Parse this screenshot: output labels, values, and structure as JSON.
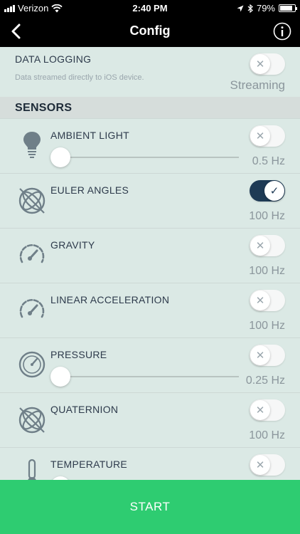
{
  "status_bar": {
    "carrier": "Verizon",
    "time": "2:40 PM",
    "battery": "79%",
    "battery_level": 0.79
  },
  "nav": {
    "title": "Config",
    "back_icon": "chevron-left-icon",
    "info_icon": "info-icon"
  },
  "logging": {
    "label": "DATA LOGGING",
    "description": "Data streamed directly to iOS device.",
    "status": "Streaming",
    "enabled": false
  },
  "sensors_header": "SENSORS",
  "sensors": [
    {
      "name": "AMBIENT LIGHT",
      "rate": "0.5 Hz",
      "enabled": false,
      "icon": "lightbulb-icon",
      "slider": 0
    },
    {
      "name": "EULER ANGLES",
      "rate": "100 Hz",
      "enabled": true,
      "icon": "gyroscope-icon"
    },
    {
      "name": "GRAVITY",
      "rate": "100 Hz",
      "enabled": false,
      "icon": "gauge-icon"
    },
    {
      "name": "LINEAR ACCELERATION",
      "rate": "100 Hz",
      "enabled": false,
      "icon": "gauge-icon"
    },
    {
      "name": "PRESSURE",
      "rate": "0.25 Hz",
      "enabled": false,
      "icon": "barometer-icon",
      "slider": 0
    },
    {
      "name": "QUATERNION",
      "rate": "100 Hz",
      "enabled": false,
      "icon": "gyroscope-icon"
    },
    {
      "name": "TEMPERATURE",
      "rate": "",
      "enabled": false,
      "icon": "thermometer-icon",
      "slider": 0
    }
  ],
  "start_label": "START",
  "colors": {
    "background": "#dbe9e5",
    "toggle_on": "#1e3a55",
    "start": "#2ecc71"
  }
}
